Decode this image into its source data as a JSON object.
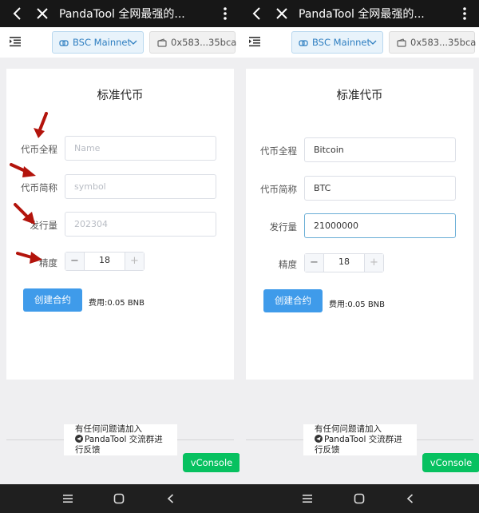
{
  "topbar": {
    "title": "PandaTool 全网最强的..."
  },
  "appbar": {
    "network": "BSC Mainnet",
    "wallet": "0x583...35bca"
  },
  "form": {
    "title": "标准代币",
    "name_label": "代币全程",
    "symbol_label": "代币简称",
    "supply_label": "发行量",
    "decimals_label": "精度",
    "create_label": "创建合约",
    "fee": "费用:0.05 BNB",
    "minus": "−",
    "plus": "+"
  },
  "left": {
    "name_placeholder": "Name",
    "symbol_placeholder": "symbol",
    "supply_placeholder": "202304",
    "decimals": "18"
  },
  "right": {
    "name_value": "Bitcoin",
    "symbol_value": "BTC",
    "supply_value": "21000000",
    "decimals": "18"
  },
  "footer": {
    "help_line1": "有任何问题请加入",
    "help_line2": "PandaTool 交流群进",
    "help_line3": "行反馈",
    "vconsole": "vConsole"
  },
  "colors": {
    "accent": "#3f9bea",
    "vconsole": "#07c160",
    "annotation_arrow": "#b3140c"
  }
}
